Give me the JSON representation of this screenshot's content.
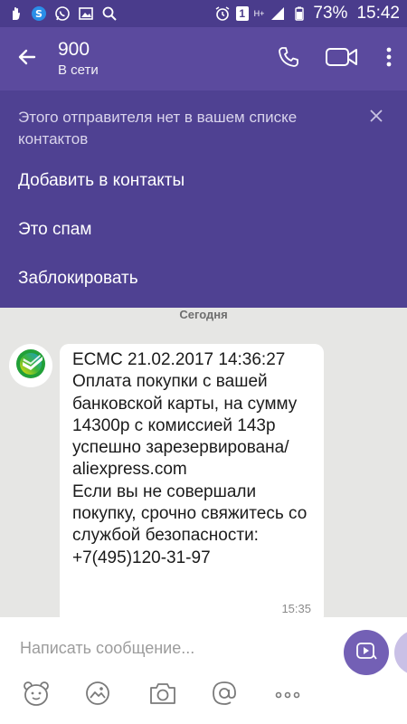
{
  "status_bar": {
    "network_top": "H+",
    "network_bottom": "",
    "sim_slot": "1",
    "battery_percent": "73%",
    "time": "15:42",
    "icons": [
      "hand-icon",
      "s-app-icon",
      "whatsapp-icon",
      "image-icon",
      "search-icon",
      "alarm-icon",
      "sim-icon",
      "signal-icon",
      "battery-icon"
    ]
  },
  "app_bar": {
    "title": "900",
    "subtitle": "В сети"
  },
  "banner": {
    "message": "Этого отправителя нет в вашем списке контактов",
    "items": [
      "Добавить в контакты",
      "Это спам",
      "Заблокировать"
    ]
  },
  "chat": {
    "date_label": "Сегодня",
    "message": {
      "text": "ЕСМС 21.02.2017 14:36:27\nОплата покупки с вашей банковской карты, на сумму 14300р с комиссией 143р успешно зарезервирована/ aliexpress.com\nЕсли вы не совершали покупку, срочно свяжитесь со службой безопасности: +7(495)120-31-97",
      "time": "15:35"
    }
  },
  "composer": {
    "placeholder": "Написать сообщение..."
  },
  "colors": {
    "status_bar": "#4a3c8c",
    "app_bar": "#5b4a9e",
    "banner": "#4f4192",
    "accent": "#7360b5",
    "sber_green": "#21a038"
  }
}
